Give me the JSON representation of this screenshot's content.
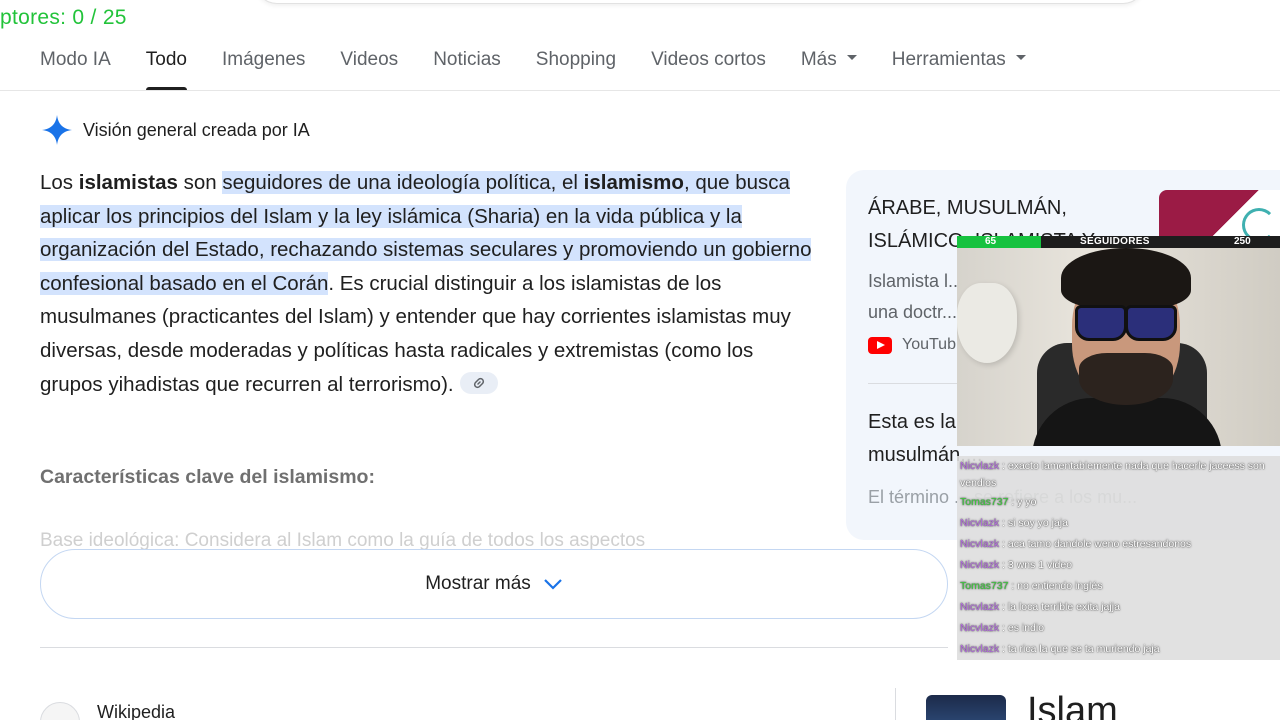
{
  "overlay": {
    "counter_text": "ptores: 0 / 25",
    "follower_goal": {
      "current": "65",
      "label": "SEGUIDORES",
      "target": "250",
      "progress": 0.26
    }
  },
  "tabs": [
    {
      "label": "Modo IA",
      "active": false
    },
    {
      "label": "Todo",
      "active": true
    },
    {
      "label": "Imágenes",
      "active": false
    },
    {
      "label": "Videos",
      "active": false
    },
    {
      "label": "Noticias",
      "active": false
    },
    {
      "label": "Shopping",
      "active": false
    },
    {
      "label": "Videos cortos",
      "active": false
    },
    {
      "label": "Más",
      "active": false,
      "dropdown": true
    },
    {
      "label": "Herramientas",
      "active": false,
      "dropdown": true
    }
  ],
  "ai_overview": {
    "header": "Visión general creada por IA",
    "icon": "gemini-sparkle-icon",
    "accent_color": "#1a73e8",
    "answer": {
      "p1": "Los ",
      "b1": "islamistas",
      "p2": " son ",
      "h1": "seguidores de una ideología política, el ",
      "hb": "islamismo",
      "h2": ", que busca aplicar los principios del Islam y la ley islámica (Sharia) en la vida pública y la organización del Estado, rechazando sistemas seculares y promoviendo un gobierno confesional basado en el Corán",
      "p3": ". Es crucial distinguir a los islamistas de los musulmanes (practicantes del Islam) y entender que hay corrientes islamistas muy diversas, desde moderadas y políticas hasta radicales y extremistas (como los grupos yihadistas que recurren al terrorismo)."
    },
    "subheading": "Características clave del islamismo:",
    "faded_line": "Base ideológica: Considera al Islam como la guía de todos los aspectos",
    "show_more": "Mostrar más"
  },
  "side_card": {
    "title": "ÁRABE, MUSULMÁN, ISLÁMICO, ISLAMISTA Y ...",
    "snippet": "Islamista l... una doctr...",
    "source": "YouTub",
    "second_title": "Esta es la ... árabe, musulmán,...",
    "second_faded": "El término ... se refiere a los mu..."
  },
  "results": {
    "wiki_label": "Wikipedia",
    "islam_title": "Islam"
  },
  "chat": [
    {
      "user": "Nicvlazk",
      "text": ": exacto lamentablemente nada que hacerle jaceess son vendios",
      "color": "#b56ee0"
    },
    {
      "user": "Tomas737",
      "text": ": y yo",
      "color": "#3ecb3e"
    },
    {
      "user": "Nicvlazk",
      "text": ": si soy yo jaja",
      "color": "#b56ee0"
    },
    {
      "user": "Nicvlazk",
      "text": ": aca tamo dandole weno estresandonos",
      "color": "#b56ee0"
    },
    {
      "user": "Nicvlazk",
      "text": ": 3 wns 1 video",
      "color": "#b56ee0"
    },
    {
      "user": "Tomas737",
      "text": ": no entiendo inglés",
      "color": "#3ecb3e"
    },
    {
      "user": "Nicvlazk",
      "text": ": la loca terrible exita jajja",
      "color": "#b56ee0"
    },
    {
      "user": "Nicvlazk",
      "text": ": es indio",
      "color": "#b56ee0"
    },
    {
      "user": "Nicvlazk",
      "text": ": ta rica la que se ta muriendo jaja",
      "color": "#b56ee0"
    }
  ]
}
